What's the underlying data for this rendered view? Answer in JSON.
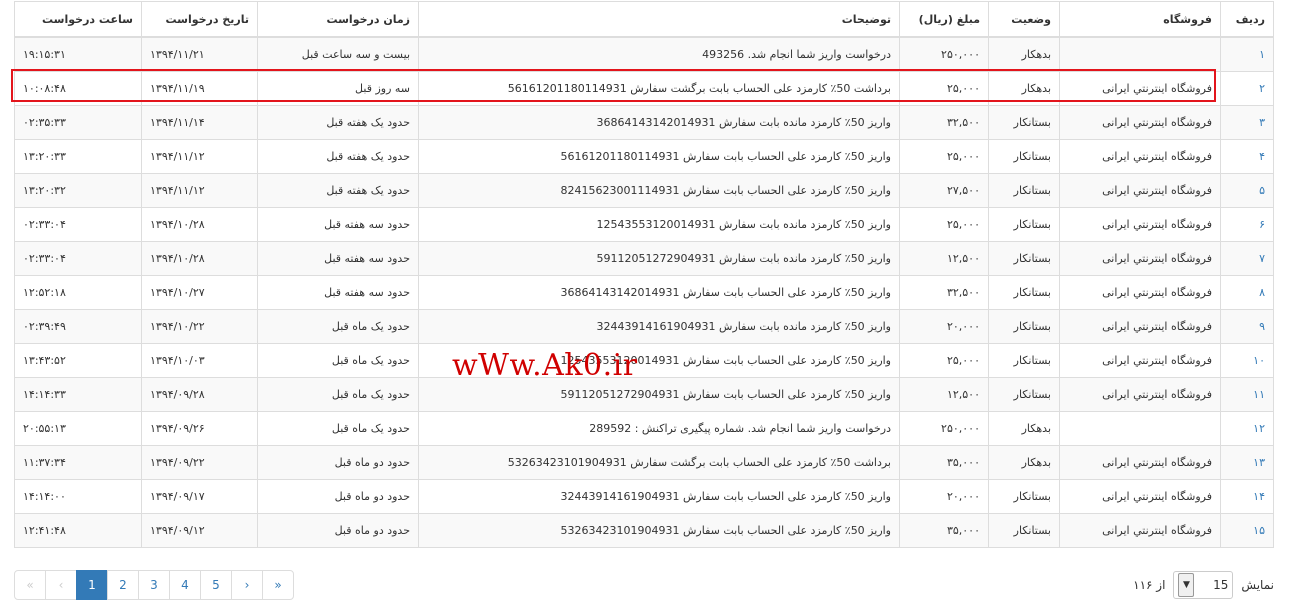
{
  "table": {
    "headers": {
      "row": "ردیف",
      "shop": "فروشگاه",
      "status": "وضعیت",
      "amount": "مبلغ (ریال)",
      "desc": "توضیحات",
      "time_ago": "زمان درخواست",
      "date": "تاریخ درخواست",
      "time": "ساعت درخواست"
    },
    "rows": [
      {
        "row": "۱",
        "shop": "",
        "status": "بدهکار",
        "amount": "۲۵۰,۰۰۰",
        "desc": "درخواست واریز شما انجام شد. 493256",
        "time_ago": "بیست و سه ساعت قبل",
        "date": "۱۳۹۴/۱۱/۲۱",
        "time": "۱۹:۱۵:۳۱"
      },
      {
        "row": "۲",
        "shop": "فروشگاه اینترنتي ایرانی",
        "status": "بدهکار",
        "amount": "۲۵,۰۰۰",
        "desc": "برداشت 50٪ کارمزد علی الحساب بابت برگشت سفارش 56161201180114931",
        "time_ago": "سه روز قبل",
        "date": "۱۳۹۴/۱۱/۱۹",
        "time": "۱۰:۰۸:۴۸"
      },
      {
        "row": "۳",
        "shop": "فروشگاه اینترنتي ایرانی",
        "status": "بستانکار",
        "amount": "۳۲,۵۰۰",
        "desc": "واریز 50٪ کارمزد مانده بابت سفارش 36864143142014931",
        "time_ago": "حدود یک هفته قبل",
        "date": "۱۳۹۴/۱۱/۱۴",
        "time": "۰۲:۳۵:۳۳"
      },
      {
        "row": "۴",
        "shop": "فروشگاه اینترنتي ایرانی",
        "status": "بستانکار",
        "amount": "۲۵,۰۰۰",
        "desc": "واریز 50٪ کارمزد علی الحساب بابت سفارش 56161201180114931",
        "time_ago": "حدود یک هفته قبل",
        "date": "۱۳۹۴/۱۱/۱۲",
        "time": "۱۳:۲۰:۳۳"
      },
      {
        "row": "۵",
        "shop": "فروشگاه اینترنتي ایرانی",
        "status": "بستانکار",
        "amount": "۲۷,۵۰۰",
        "desc": "واریز 50٪ کارمزد علی الحساب بابت سفارش 82415623001114931",
        "time_ago": "حدود یک هفته قبل",
        "date": "۱۳۹۴/۱۱/۱۲",
        "time": "۱۳:۲۰:۳۲"
      },
      {
        "row": "۶",
        "shop": "فروشگاه اینترنتي ایرانی",
        "status": "بستانکار",
        "amount": "۲۵,۰۰۰",
        "desc": "واریز 50٪ کارمزد مانده بابت سفارش 12543553120014931",
        "time_ago": "حدود سه هفته قبل",
        "date": "۱۳۹۴/۱۰/۲۸",
        "time": "۰۲:۳۳:۰۴"
      },
      {
        "row": "۷",
        "shop": "فروشگاه اینترنتي ایرانی",
        "status": "بستانکار",
        "amount": "۱۲,۵۰۰",
        "desc": "واریز 50٪ کارمزد مانده بابت سفارش 59112051272904931",
        "time_ago": "حدود سه هفته قبل",
        "date": "۱۳۹۴/۱۰/۲۸",
        "time": "۰۲:۳۳:۰۴"
      },
      {
        "row": "۸",
        "shop": "فروشگاه اینترنتي ایرانی",
        "status": "بستانکار",
        "amount": "۳۲,۵۰۰",
        "desc": "واریز 50٪ کارمزد علی الحساب بابت سفارش 36864143142014931",
        "time_ago": "حدود سه هفته قبل",
        "date": "۱۳۹۴/۱۰/۲۷",
        "time": "۱۲:۵۲:۱۸"
      },
      {
        "row": "۹",
        "shop": "فروشگاه اینترنتي ایرانی",
        "status": "بستانکار",
        "amount": "۲۰,۰۰۰",
        "desc": "واریز 50٪ کارمزد مانده بابت سفارش 32443914161904931",
        "time_ago": "حدود یک ماه قبل",
        "date": "۱۳۹۴/۱۰/۲۲",
        "time": "۰۲:۳۹:۴۹"
      },
      {
        "row": "۱۰",
        "shop": "فروشگاه اینترنتي ایرانی",
        "status": "بستانکار",
        "amount": "۲۵,۰۰۰",
        "desc": "واریز 50٪ کارمزد علی الحساب بابت سفارش 12543553120014931",
        "time_ago": "حدود یک ماه قبل",
        "date": "۱۳۹۴/۱۰/۰۳",
        "time": "۱۳:۴۳:۵۲"
      },
      {
        "row": "۱۱",
        "shop": "فروشگاه اینترنتي ایرانی",
        "status": "بستانکار",
        "amount": "۱۲,۵۰۰",
        "desc": "واریز 50٪ کارمزد علی الحساب بابت سفارش 59112051272904931",
        "time_ago": "حدود یک ماه قبل",
        "date": "۱۳۹۴/۰۹/۲۸",
        "time": "۱۴:۱۴:۳۳"
      },
      {
        "row": "۱۲",
        "shop": "",
        "status": "بدهکار",
        "amount": "۲۵۰,۰۰۰",
        "desc": "درخواست واریز شما انجام شد. شماره پیگیری تراکنش : 289592",
        "time_ago": "حدود یک ماه قبل",
        "date": "۱۳۹۴/۰۹/۲۶",
        "time": "۲۰:۵۵:۱۳"
      },
      {
        "row": "۱۳",
        "shop": "فروشگاه اینترنتي ایرانی",
        "status": "بدهکار",
        "amount": "۳۵,۰۰۰",
        "desc": "برداشت 50٪ کارمزد علی الحساب بابت برگشت سفارش 53263423101904931",
        "time_ago": "حدود دو ماه قبل",
        "date": "۱۳۹۴/۰۹/۲۲",
        "time": "۱۱:۳۷:۳۴"
      },
      {
        "row": "۱۴",
        "shop": "فروشگاه اینترنتي ایرانی",
        "status": "بستانکار",
        "amount": "۲۰,۰۰۰",
        "desc": "واریز 50٪ کارمزد علی الحساب بابت سفارش 32443914161904931",
        "time_ago": "حدود دو ماه قبل",
        "date": "۱۳۹۴/۰۹/۱۷",
        "time": "۱۴:۱۴:۰۰"
      },
      {
        "row": "۱۵",
        "shop": "فروشگاه اینترنتي ایرانی",
        "status": "بستانکار",
        "amount": "۳۵,۰۰۰",
        "desc": "واریز 50٪ کارمزد علی الحساب بابت سفارش 53263423101904931",
        "time_ago": "حدود دو ماه قبل",
        "date": "۱۳۹۴/۰۹/۱۲",
        "time": "۱۲:۴۱:۴۸"
      }
    ]
  },
  "watermark": "wWw.Ak0.ir",
  "pagination": {
    "first": "«",
    "prev": "‹",
    "pages": [
      "1",
      "2",
      "3",
      "4",
      "5"
    ],
    "active_page": "1",
    "next": "›",
    "last": "»"
  },
  "page_size": {
    "label": "نمایش",
    "value": "15",
    "of_label": "از ۱۱۶"
  },
  "colors": {
    "link": "#337ab7",
    "highlight_border": "#e3151c",
    "watermark": "#d00000"
  }
}
